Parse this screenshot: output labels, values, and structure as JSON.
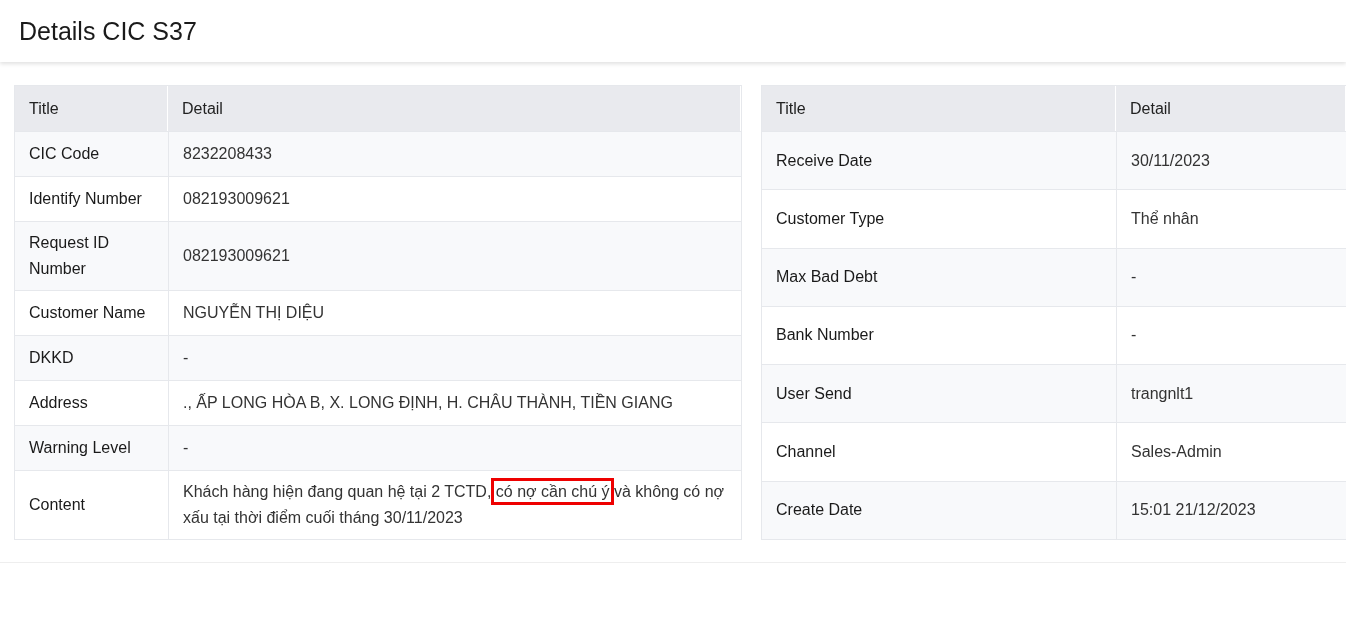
{
  "page": {
    "title": "Details CIC S37"
  },
  "left_table": {
    "columns": [
      "Title",
      "Detail"
    ],
    "rows": [
      {
        "title": "CIC Code",
        "detail": "8232208433"
      },
      {
        "title": "Identify Number",
        "detail": "082193009621"
      },
      {
        "title": "Request ID Number",
        "detail": "082193009621"
      },
      {
        "title": "Customer Name",
        "detail": "NGUYỄN THỊ DIỆU"
      },
      {
        "title": "DKKD",
        "detail": "-"
      },
      {
        "title": "Address",
        "detail": "., ẤP LONG HÒA B, X. LONG ĐỊNH, H. CHÂU THÀNH, TIỀN GIANG"
      },
      {
        "title": "Warning Level",
        "detail": "-"
      },
      {
        "title": "Content",
        "segments": [
          {
            "text": "Khách hàng hiện đang quan hệ tại 2 TCTD, ",
            "highlighted": false
          },
          {
            "text": "có nợ cần chú ý",
            "highlighted": true
          },
          {
            "text": " và không có nợ xấu tại thời điểm cuối tháng 30/11/2023",
            "highlighted": false
          }
        ]
      }
    ]
  },
  "right_table": {
    "columns": [
      "Title",
      "Detail"
    ],
    "rows": [
      {
        "title": "Receive Date",
        "detail": "30/11/2023"
      },
      {
        "title": "Customer Type",
        "detail": "Thể nhân"
      },
      {
        "title": "Max Bad Debt",
        "detail": "-"
      },
      {
        "title": "Bank Number",
        "detail": "-"
      },
      {
        "title": "User Send",
        "detail": "trangnlt1"
      },
      {
        "title": "Channel",
        "detail": "Sales-Admin"
      },
      {
        "title": "Create Date",
        "detail": "15:01 21/12/2023"
      }
    ]
  }
}
